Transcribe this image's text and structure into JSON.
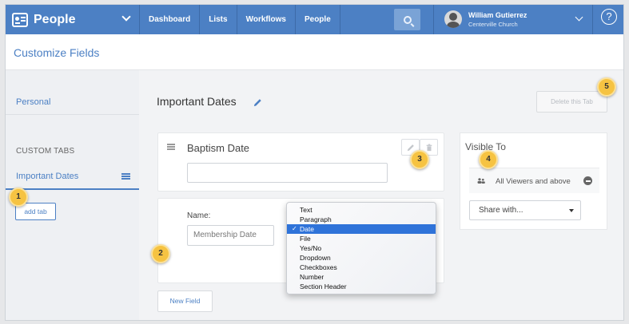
{
  "topbar": {
    "app_name": "People",
    "nav": [
      "Dashboard",
      "Lists",
      "Workflows",
      "People"
    ],
    "user_name": "William Gutierrez",
    "user_org": "Centerville Church",
    "help": "?"
  },
  "page": {
    "title": "Customize Fields"
  },
  "sidebar": {
    "personal": "Personal",
    "custom_heading": "CUSTOM TABS",
    "active_tab": "Important Dates",
    "add_tab": "add tab"
  },
  "main": {
    "tab_title": "Important Dates",
    "delete_tab": "Delete this Tab",
    "field_label": "Baptism Date",
    "name_label": "Name:",
    "name_placeholder": "Membership Date",
    "new_field": "New Field"
  },
  "visibility": {
    "title": "Visible To",
    "viewers": "All Viewers and above",
    "share": "Share with..."
  },
  "dropdown": {
    "options": [
      "Text",
      "Paragraph",
      "Date",
      "File",
      "Yes/No",
      "Dropdown",
      "Checkboxes",
      "Number",
      "Section Header"
    ],
    "selected": "Date",
    "check": "✓"
  },
  "callouts": [
    "1",
    "2",
    "3",
    "4",
    "5"
  ],
  "colors": {
    "accent": "#4c80c4",
    "selected": "#2f73d9",
    "callout": "#f6c342"
  }
}
